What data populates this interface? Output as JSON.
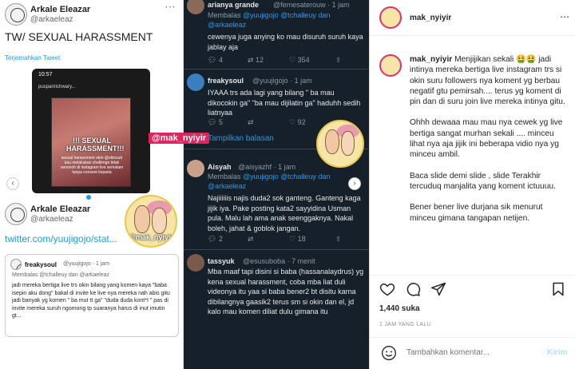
{
  "left_tweet": {
    "name": "Arkale Eleazar",
    "handle": "@arkaeleaz",
    "title": "TW/ SEXUAL HARASSMENT",
    "translate": "Terjemahkan Tweet",
    "phone": {
      "status": "10:57",
      "user": "pusparirichwary...",
      "overlay_title": "!!! SEXUAL HARASSMENT!!!",
      "overlay_sub": "sexual harassment oleh @okinsub kau melakukan challenge tidak senonoh di instagram live semalam tanpa consent kepada"
    },
    "second_name": "Arkale Eleazar",
    "second_handle": "@arkaeleaz",
    "link": "twitter.com/yuujigojo/stat...",
    "quote": {
      "name": "freakysoul",
      "handle": "@yuujigojo · 1 jam",
      "reply": "Membalas @tchalleuy dan @arkaeleaz",
      "text": "jadi mereka bertiga live trs okin bilang yang komen kaya \"baba isepin aku dong\" bakal di invite ke live nya mereka nah abis gitu jadi banyak yg komen \" ba mut tt ga\" \"duda duda kont*I \" pas di invite mereka suruh ngomong tp suaranya harus di inut imutin gt..."
    }
  },
  "dark_thread": {
    "tweets": [
      {
        "name": "arianya grande",
        "handle": "@femesaterouw · 1 jam",
        "reply_prefix": "Membalas",
        "reply_users": "@yuujigojo @tchalleuy dan",
        "reply_users2": "@arkaeleaz",
        "text": "cewenya juga anying ko mau disuruh suruh kaya jablay aja",
        "replies": "4",
        "retweets": "12",
        "likes": "354"
      },
      {
        "name": "freakysoul",
        "handle": "@yuujigojo · 1 jam",
        "text": "IYAAA trs ada lagi yang bilang \" ba mau dikocokin ga\" \"ba mau dijilatin ga\" haduhh sedih liatnyaa",
        "replies": "5",
        "retweets": "",
        "likes": "92",
        "show_replies": "Tampilkan balasan"
      },
      {
        "name": "Aisyah",
        "handle": "@aisyazhf · 1 jam",
        "reply_prefix": "Membalas",
        "reply_users": "@yuujigojo @tchalleuy dan",
        "reply_users2": "@arkaeleaz",
        "text": "Najiiiiiis najis duda2 sok ganteng. Ganteng kaga jijik iya. Pake posting kata2 sayyidina Usman pula. Malu lah ama anak seenggaknya. Nakal boleh, jahat & goblok jangan.",
        "replies": "2",
        "retweets": "",
        "likes": "18"
      },
      {
        "name": "tassyuk",
        "handle": "@esusuboba · 7 menit",
        "text": "Mba maaf tapi disini si baba (hassanalaydrus) yg kena sexual harassment, coba mba liat duli videonya itu yaa si baba bener2 bt disitu karna dibilangnya gaasik2 terus sm si okin dan el, jd kalo mau komen diliat dulu gimana itu"
      }
    ],
    "watermark": "@mak_nyiyir"
  },
  "sticker_label": "@mak_nyiyir",
  "instagram": {
    "username": "mak_nyiyir",
    "caption_user": "mak_nyiyir",
    "caption_p1": "Menjijikan sekali 🤮🤮 jadi intinya mereka bertiga live instagram trs si okin suru followers nya koment yg berbau negatif gtu pemirsah.... terus yg koment di pin dan di suru join live mereka intinya gitu.",
    "caption_p2": "Ohhh dewaaa mau mau nya cewek yg live bertiga sangat murhan sekali .... minceu lihat nya aja jijik ini beberapa vidio nya yg minceu ambil.",
    "caption_p3": "Baca slide demi slide , slide Terakhir tercuduq manjalita yang koment ictuuuu.",
    "caption_p4": "Bener bener live durjana sik menurut minceu gimana tangapan netijen.",
    "likes": "1,440 suka",
    "date": "1 JAM YANG LALU",
    "comment_placeholder": "Tambahkan komentar...",
    "post_label": "Kirim"
  }
}
